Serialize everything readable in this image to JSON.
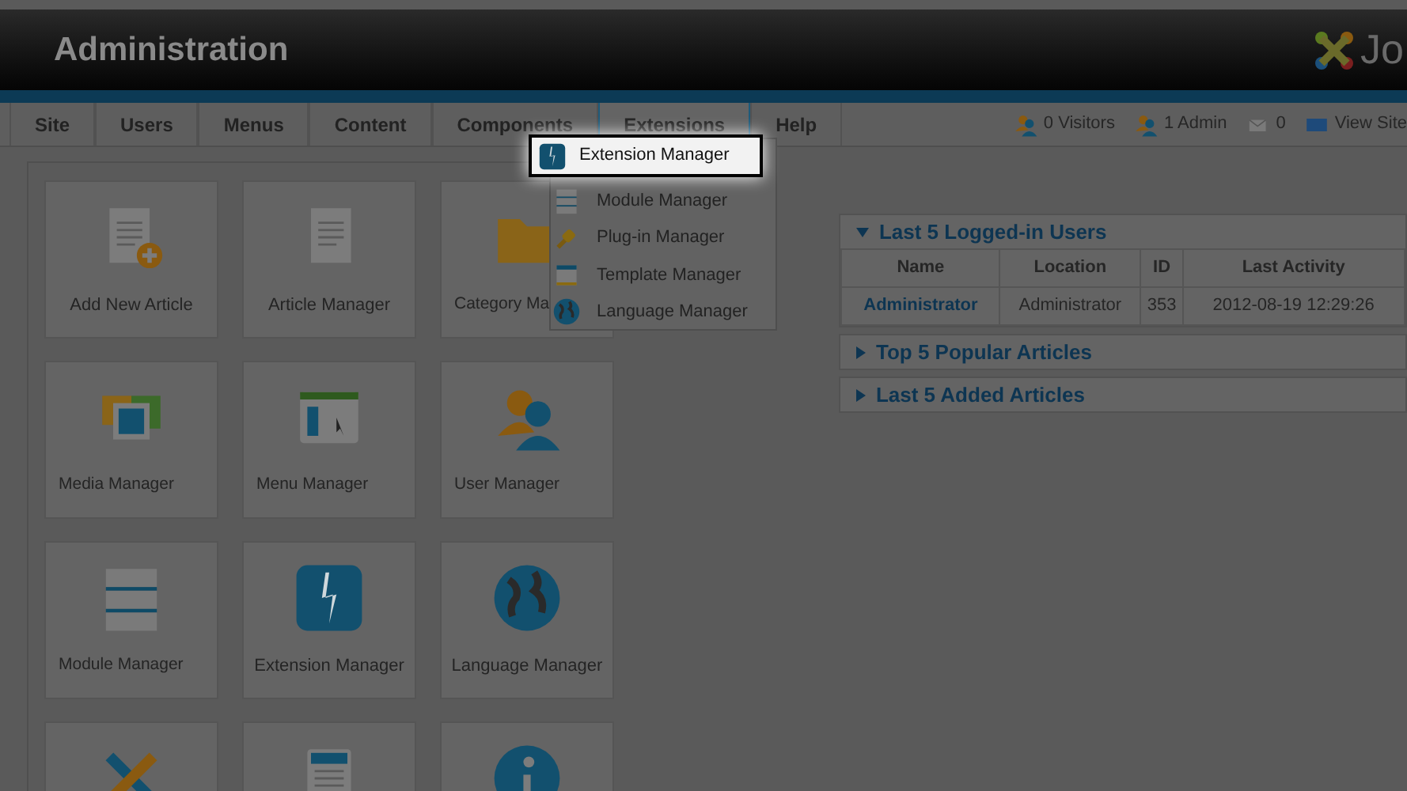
{
  "header": {
    "title": "Administration",
    "logo_text": "Jo"
  },
  "menu": [
    {
      "label": "Site",
      "selected": false
    },
    {
      "label": "Users",
      "selected": false
    },
    {
      "label": "Menus",
      "selected": false
    },
    {
      "label": "Content",
      "selected": false
    },
    {
      "label": "Components",
      "selected": false
    },
    {
      "label": "Extensions",
      "selected": true
    },
    {
      "label": "Help",
      "selected": false
    }
  ],
  "status": [
    {
      "kind": "users",
      "text": "0 Visitors"
    },
    {
      "kind": "users",
      "text": "1 Admin"
    },
    {
      "kind": "mail",
      "text": "0"
    },
    {
      "kind": "screen",
      "text": "View Site"
    }
  ],
  "dropdown": [
    {
      "kind": "bolt",
      "label": "Extension Manager",
      "selected": true
    },
    {
      "kind": "stack",
      "label": "Module Manager",
      "selected": false
    },
    {
      "kind": "plug",
      "label": "Plug-in Manager",
      "selected": false
    },
    {
      "kind": "window",
      "label": "Template Manager",
      "selected": false
    },
    {
      "kind": "globe",
      "label": "Language Manager",
      "selected": false
    }
  ],
  "tiles": [
    {
      "kind": "add-article",
      "label": "Add New Article"
    },
    {
      "kind": "article",
      "label": "Article Manager"
    },
    {
      "kind": "folder",
      "label": "Category Ma"
    },
    {
      "kind": "media",
      "label": "Media Manager"
    },
    {
      "kind": "menu",
      "label": "Menu Manager"
    },
    {
      "kind": "users",
      "label": "User Manager"
    },
    {
      "kind": "stack",
      "label": "Module Manager"
    },
    {
      "kind": "bolt",
      "label": "Extension Manager"
    },
    {
      "kind": "globe",
      "label": "Language Manager"
    },
    {
      "kind": "tools"
    },
    {
      "kind": "document"
    },
    {
      "kind": "info"
    }
  ],
  "panels": [
    {
      "title": "Last 5 Logged-in Users",
      "expanded": true,
      "table": {
        "columns": [
          "Name",
          "Location",
          "ID",
          "Last Activity"
        ],
        "rows": [
          [
            "Administrator",
            "Administrator",
            "353",
            "2012-08-19 12:29:26"
          ]
        ]
      }
    },
    {
      "title": "Top 5 Popular Articles",
      "expanded": false
    },
    {
      "title": "Last 5 Added Articles",
      "expanded": false
    }
  ]
}
